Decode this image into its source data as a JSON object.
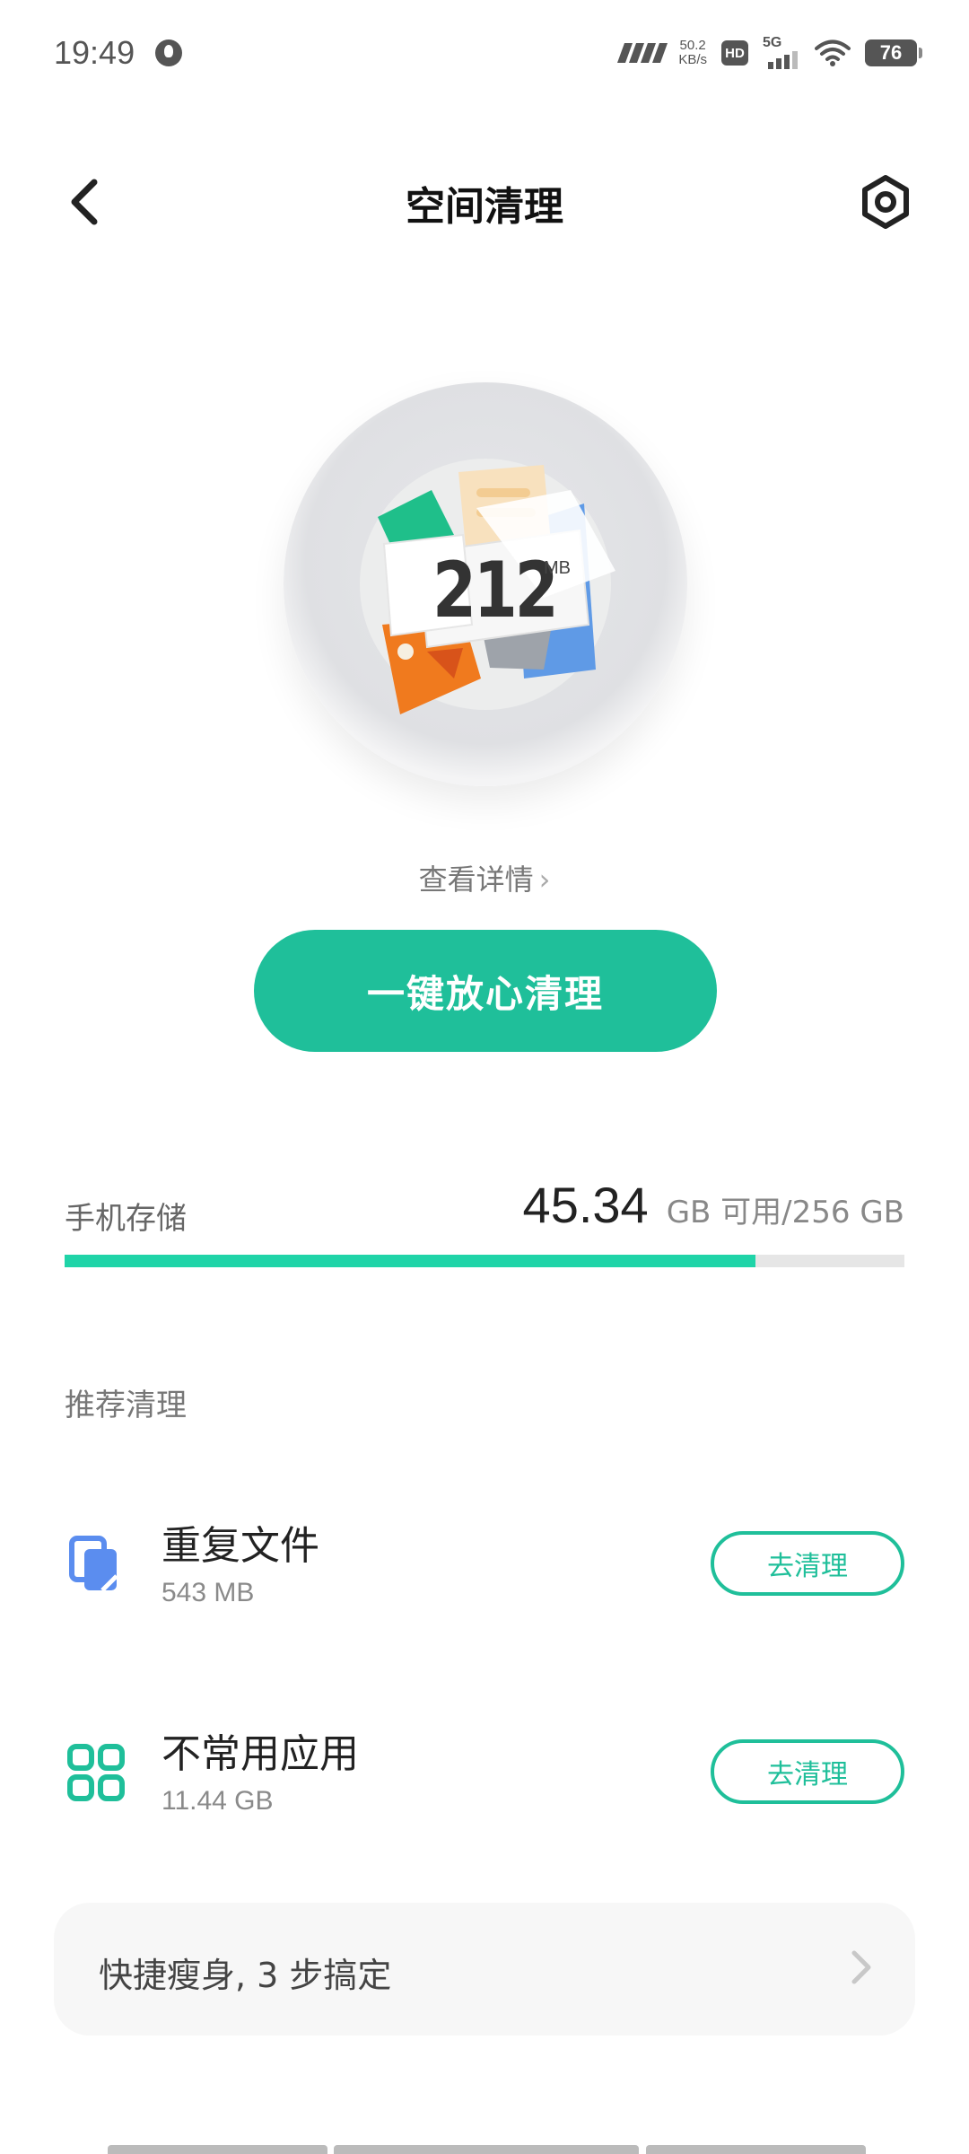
{
  "status_bar": {
    "time": "19:49",
    "net_speed_value": "50.2",
    "net_speed_unit": "KB/s",
    "hd": "HD",
    "network": "5G",
    "battery": "76"
  },
  "header": {
    "title": "空间清理",
    "back_icon": "chevron-left-icon",
    "settings_icon": "gear-icon"
  },
  "junk": {
    "size": "212",
    "unit": "MB",
    "details_label": "查看详情"
  },
  "clean_button": {
    "label": "一键放心清理"
  },
  "storage": {
    "label": "手机存储",
    "free": "45.34",
    "suffix": "GB 可用/256 GB",
    "used_fraction": 0.823
  },
  "recommend": {
    "title": "推荐清理",
    "items": [
      {
        "title": "重复文件",
        "size": "543 MB",
        "button": "去清理",
        "icon": "duplicate-files-icon"
      },
      {
        "title": "不常用应用",
        "size": "11.44 GB",
        "button": "去清理",
        "icon": "apps-grid-icon"
      }
    ]
  },
  "quick_slim": {
    "label": "快捷瘦身, 3 步搞定"
  },
  "colors": {
    "accent": "#1fbf9a",
    "storage_fill": "#1fd4a8",
    "files_icon": "#5b8def"
  }
}
